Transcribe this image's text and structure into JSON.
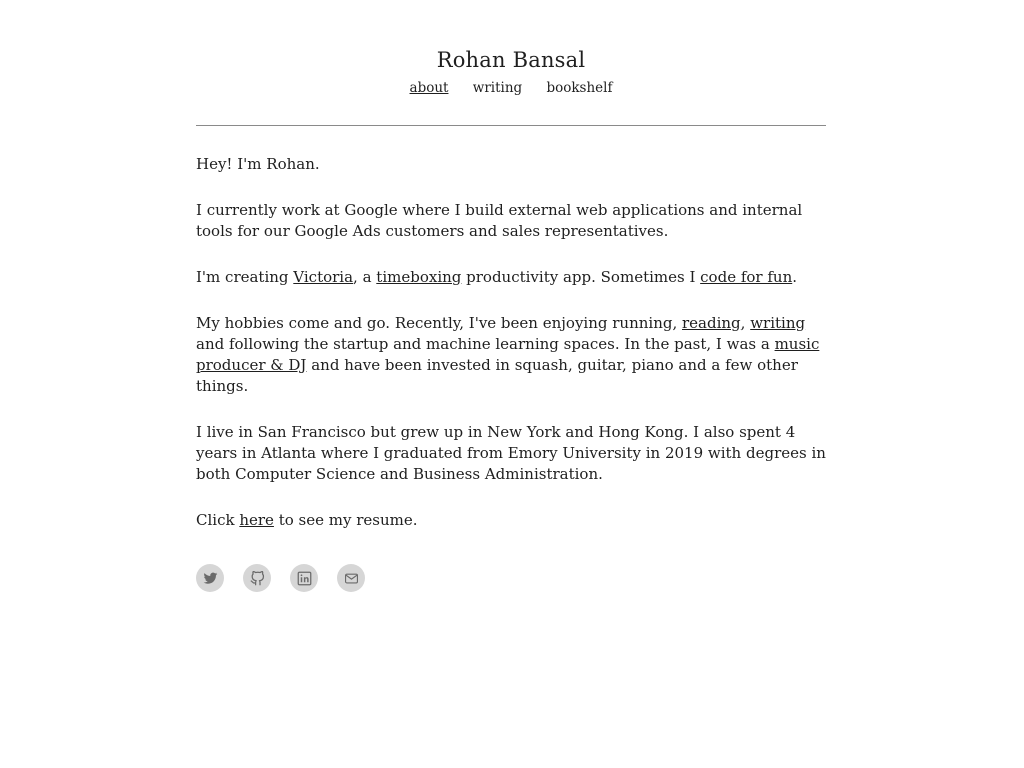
{
  "header": {
    "title": "Rohan Bansal",
    "nav": [
      {
        "label": "about",
        "active": true
      },
      {
        "label": "writing",
        "active": false
      },
      {
        "label": "bookshelf",
        "active": false
      }
    ]
  },
  "content": {
    "greeting": "Hey! I'm Rohan.",
    "work": "I currently work at Google where I build external web applications and internal tools for our Google Ads customers and sales representatives.",
    "creating": {
      "prefix": "I'm creating ",
      "link1": "Victoria",
      "mid1": ", a ",
      "link2": "timeboxing",
      "mid2": " productivity app. Sometimes I ",
      "link3": "code for fun",
      "suffix": "."
    },
    "hobbies": {
      "prefix": "My hobbies come and go. Recently, I've been enjoying running, ",
      "link1": "reading",
      "mid1": ", ",
      "link2": "writing",
      "mid2": " and following the startup and machine learning spaces. In the past, I was a ",
      "link3": "music producer & DJ",
      "suffix": " and have been invested in squash, guitar, piano and a few other things."
    },
    "location": "I live in San Francisco but grew up in New York and Hong Kong. I also spent 4 years in Atlanta where I graduated from Emory University in 2019 with degrees in both Computer Science and Business Administration.",
    "resume": {
      "prefix": "Click ",
      "link": "here",
      "suffix": " to see my resume."
    }
  },
  "social": [
    {
      "icon": "twitter-icon"
    },
    {
      "icon": "github-icon"
    },
    {
      "icon": "linkedin-icon"
    },
    {
      "icon": "email-icon"
    }
  ],
  "colors": {
    "text": "#1f1f1f",
    "icon_bg": "#d6d6d6",
    "icon_fg": "#6a6a6a",
    "divider": "#8a8a8a"
  }
}
